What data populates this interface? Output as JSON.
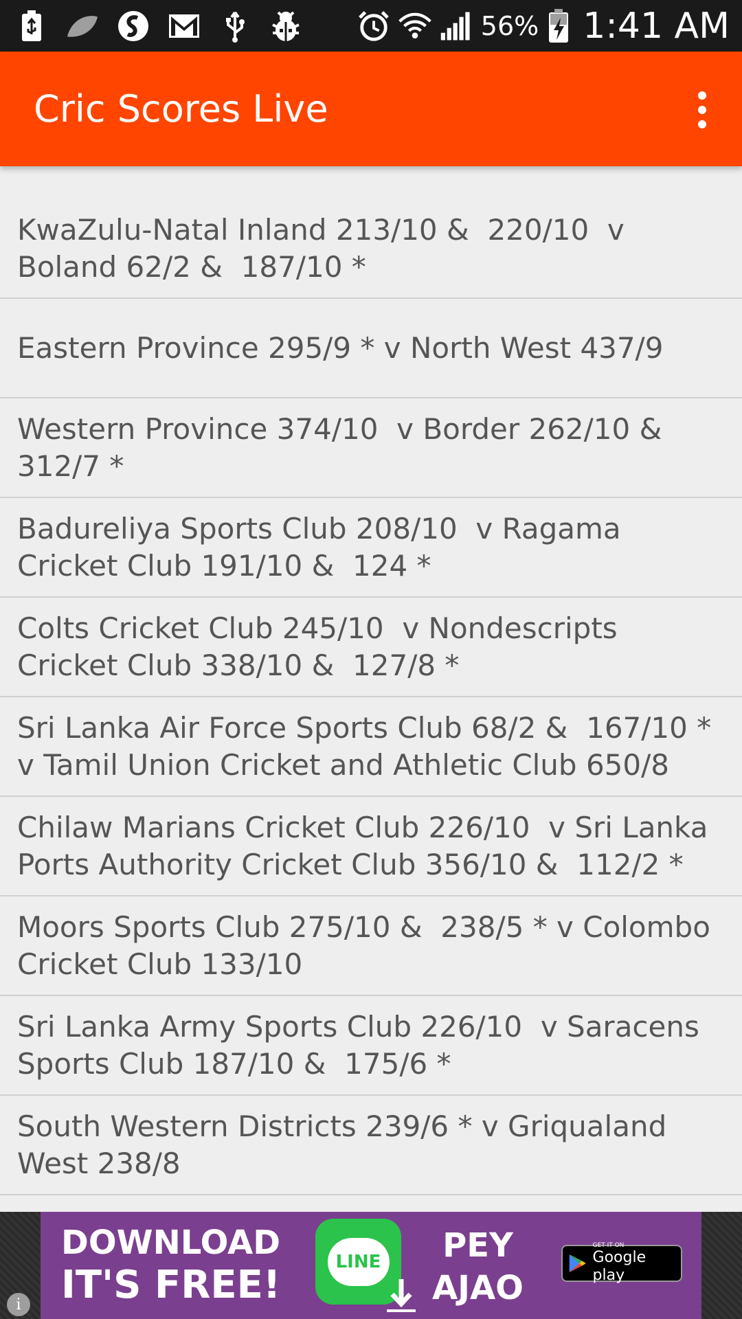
{
  "status_bar": {
    "battery_percent": "56%",
    "time": "1:41 AM",
    "icons": [
      "usb-battery-icon",
      "leaf-icon",
      "shazam-icon",
      "gmail-icon",
      "usb-icon",
      "debug-bug-icon",
      "alarm-icon",
      "wifi-icon",
      "signal-icon",
      "charging-battery-icon"
    ]
  },
  "app_bar": {
    "title": "Cric Scores Live",
    "background": "#ff4500",
    "overflow_icon": "overflow-menu-icon"
  },
  "matches": [
    "KwaZulu-Natal Inland 213/10 &  220/10  v Boland 62/2 &  187/10 *",
    "Eastern Province 295/9 * v North West 437/9",
    "Western Province 374/10  v Border 262/10 & 312/7 *",
    "Badureliya Sports Club 208/10  v Ragama Cricket Club 191/10 &  124 *",
    "Colts Cricket Club 245/10  v Nondescripts Cricket Club 338/10 &  127/8 *",
    "Sri Lanka Air Force Sports Club 68/2 &  167/10 * v Tamil Union Cricket and Athletic Club 650/8",
    "Chilaw Marians Cricket Club 226/10  v Sri Lanka Ports Authority Cricket Club 356/10 &  112/2 *",
    "Moors Sports Club 275/10 &  238/5 * v Colombo Cricket Club 133/10",
    "Sri Lanka Army Sports Club 226/10  v Saracens Sports Club 187/10 &  175/6 *",
    "South Western Districts 239/6 * v Griqualand West 238/8"
  ],
  "ad": {
    "line1": "DOWNLOAD",
    "line2": "IT'S FREE!",
    "logo_text": "LINE",
    "right1": "PEY",
    "right2": "AJAO",
    "badge_small": "GET IT ON",
    "badge_big": "Google play",
    "info": "i"
  }
}
